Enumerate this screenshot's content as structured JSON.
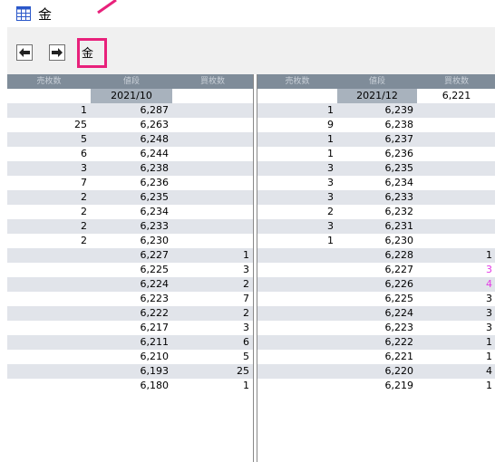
{
  "window": {
    "title": "金",
    "icon": "grid-icon"
  },
  "toolbar": {
    "back_icon": "arrow-left-icon",
    "forward_icon": "arrow-right-icon",
    "label": "金",
    "highlight_color": "#e8217b"
  },
  "left_panel": {
    "headers": [
      "売枚数",
      "値段",
      "買枚数"
    ],
    "date": "2021/10",
    "rows": [
      [
        "1",
        "6,287",
        ""
      ],
      [
        "25",
        "6,263",
        ""
      ],
      [
        "5",
        "6,248",
        ""
      ],
      [
        "6",
        "6,244",
        ""
      ],
      [
        "3",
        "6,238",
        ""
      ],
      [
        "7",
        "6,236",
        ""
      ],
      [
        "2",
        "6,235",
        ""
      ],
      [
        "2",
        "6,234",
        ""
      ],
      [
        "2",
        "6,233",
        ""
      ],
      [
        "2",
        "6,230",
        ""
      ],
      [
        "",
        "6,227",
        "1"
      ],
      [
        "",
        "6,225",
        "3"
      ],
      [
        "",
        "6,224",
        "2"
      ],
      [
        "",
        "6,223",
        "7"
      ],
      [
        "",
        "6,222",
        "2"
      ],
      [
        "",
        "6,217",
        "3"
      ],
      [
        "",
        "6,211",
        "6"
      ],
      [
        "",
        "6,210",
        "5"
      ],
      [
        "",
        "6,193",
        "25"
      ],
      [
        "",
        "6,180",
        "1"
      ]
    ]
  },
  "right_panel": {
    "headers": [
      "売枚数",
      "値段",
      "買枚数"
    ],
    "date": "2021/12",
    "date_extra": "6,221",
    "rows": [
      [
        "1",
        "6,239",
        ""
      ],
      [
        "9",
        "6,238",
        ""
      ],
      [
        "1",
        "6,237",
        ""
      ],
      [
        "1",
        "6,236",
        ""
      ],
      [
        "3",
        "6,235",
        ""
      ],
      [
        "3",
        "6,234",
        ""
      ],
      [
        "3",
        "6,233",
        ""
      ],
      [
        "2",
        "6,232",
        ""
      ],
      [
        "3",
        "6,231",
        ""
      ],
      [
        "1",
        "6,230",
        ""
      ],
      [
        "",
        "6,228",
        "1"
      ],
      [
        "",
        "6,227",
        "3"
      ],
      [
        "",
        "6,226",
        "4"
      ],
      [
        "",
        "6,225",
        "3"
      ],
      [
        "",
        "6,224",
        "3"
      ],
      [
        "",
        "6,223",
        "3"
      ],
      [
        "",
        "6,222",
        "1"
      ],
      [
        "",
        "6,221",
        "1"
      ],
      [
        "",
        "6,220",
        "4"
      ],
      [
        "",
        "6,219",
        "1"
      ]
    ],
    "pink_rows": [
      11,
      12
    ]
  }
}
